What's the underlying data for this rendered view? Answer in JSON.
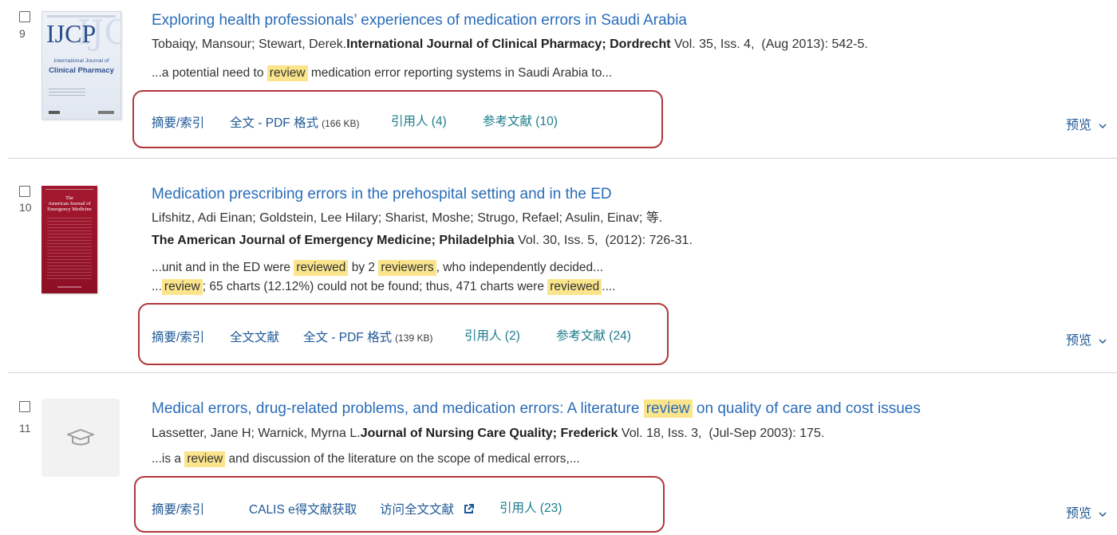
{
  "colors": {
    "title": "#2a6cb8",
    "link": "#1f5896",
    "link_alt": "#1c7c8c",
    "highlight": "#fbe58c",
    "annotation": "#b0383b"
  },
  "icons": {
    "thumbnail_placeholder": "graduation-cap-icon",
    "external_link": "external-link-icon",
    "preview_toggle": "chevron-down-icon"
  },
  "results": [
    {
      "number": "9",
      "thumbnail": {
        "abbr": "IJCP",
        "line1": "International Journal of",
        "line2": "Clinical Pharmacy"
      },
      "title": [
        {
          "text": "Exploring health professionals’ experiences of medication errors in Saudi Arabia"
        }
      ],
      "authors": "Tobaiqy, Mansour; Stewart, Derek.",
      "journal": "International Journal of Clinical Pharmacy; Dordrecht",
      "citation": " Vol. 35, Iss. 4,  (Aug 2013): 542-5.",
      "snippet": [
        [
          {
            "text": "...a potential need to "
          },
          {
            "text": "review",
            "highlight": true
          },
          {
            "text": " medication error reporting systems in Saudi Arabia to..."
          }
        ]
      ],
      "links": [
        {
          "label": "摘要/索引"
        },
        {
          "label": "全文 - PDF 格式",
          "size": "(166 KB)"
        },
        {
          "label": "引用人 (4)"
        },
        {
          "label": "参考文献 (10)"
        }
      ],
      "preview": "预览"
    },
    {
      "number": "10",
      "thumbnail": {
        "lines": [
          "The",
          "American Journal of",
          "Emergency Medicine"
        ]
      },
      "title": [
        {
          "text": "Medication prescribing errors in the prehospital setting and in the ED"
        }
      ],
      "authors": "Lifshitz, Adi Einan; Goldstein, Lee Hilary; Sharist, Moshe; Strugo, Refael; Asulin, Einav; 等.",
      "journal": "The American Journal of Emergency Medicine; Philadelphia",
      "citation": " Vol. 30, Iss. 5,  (2012): 726-31.",
      "snippet": [
        [
          {
            "text": "...unit and in the ED were "
          },
          {
            "text": "reviewed",
            "highlight": true
          },
          {
            "text": " by 2 "
          },
          {
            "text": "reviewers",
            "highlight": true
          },
          {
            "text": ", who independently decided..."
          }
        ],
        [
          {
            "text": "..."
          },
          {
            "text": "review",
            "highlight": true
          },
          {
            "text": "; 65 charts (12.12%) could not be found; thus, 471 charts were "
          },
          {
            "text": "reviewed",
            "highlight": true
          },
          {
            "text": "...."
          }
        ]
      ],
      "links": [
        {
          "label": "摘要/索引"
        },
        {
          "label": "全文文献"
        },
        {
          "label": "全文 - PDF 格式",
          "size": "(139 KB)"
        },
        {
          "label": "引用人 (2)"
        },
        {
          "label": "参考文献 (24)"
        }
      ],
      "preview": "预览"
    },
    {
      "number": "11",
      "title": [
        {
          "text": "Medical errors, drug-related problems, and medication errors: A literature "
        },
        {
          "text": "review",
          "highlight": true
        },
        {
          "text": " on quality of care and cost issues"
        }
      ],
      "authors": "Lassetter, Jane H; Warnick, Myrna L.",
      "journal": "Journal of Nursing Care Quality; Frederick",
      "citation": " Vol. 18, Iss. 3,  (Jul-Sep 2003): 175.",
      "snippet": [
        [
          {
            "text": "...is a "
          },
          {
            "text": "review",
            "highlight": true
          },
          {
            "text": " and discussion of the literature on the scope of medical errors,..."
          }
        ]
      ],
      "links": [
        {
          "label": "摘要/索引"
        },
        {
          "label": "CALIS e得文献获取"
        },
        {
          "label": "访问全文文献",
          "external": true
        },
        {
          "label": "引用人 (23)"
        }
      ],
      "preview": "预览"
    }
  ]
}
